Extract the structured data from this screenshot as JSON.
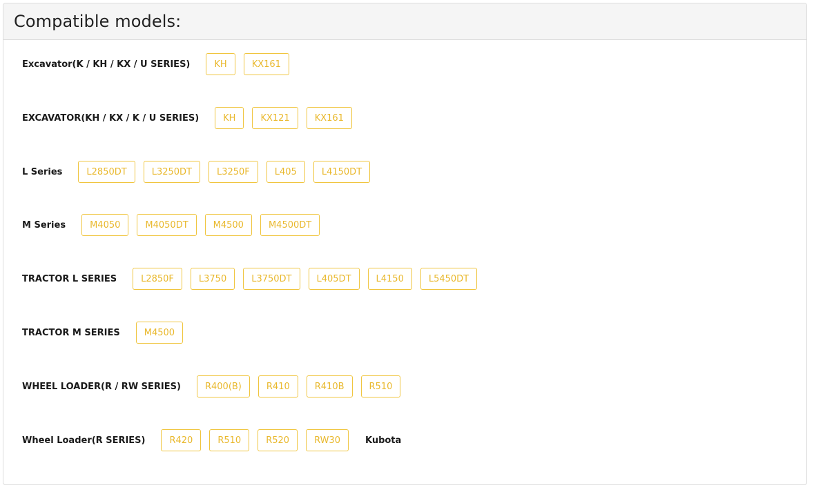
{
  "panel": {
    "title": "Compatible models:"
  },
  "rows": [
    {
      "label": "Excavator(K / KH / KX / U SERIES)",
      "tags": [
        "KH",
        "KX161"
      ]
    },
    {
      "label": "EXCAVATOR(KH / KX / K / U SERIES)",
      "tags": [
        "KH",
        "KX121",
        "KX161"
      ]
    },
    {
      "label": "L Series",
      "tags": [
        "L2850DT",
        "L3250DT",
        "L3250F",
        "L405",
        "L4150DT"
      ]
    },
    {
      "label": "M Series",
      "tags": [
        "M4050",
        "M4050DT",
        "M4500",
        "M4500DT"
      ]
    },
    {
      "label": "TRACTOR L SERIES",
      "tags": [
        "L2850F",
        "L3750",
        "L3750DT",
        "L405DT",
        "L4150",
        "L5450DT"
      ]
    },
    {
      "label": "TRACTOR M SERIES",
      "tags": [
        "M4500"
      ]
    },
    {
      "label": "WHEEL LOADER(R / RW SERIES)",
      "tags": [
        "R400(B)",
        "R410",
        "R410B",
        "R510"
      ]
    },
    {
      "label": "Wheel Loader(R SERIES)",
      "tags": [
        "R420",
        "R510",
        "R520",
        "RW30"
      ],
      "brand": "Kubota"
    }
  ],
  "colors": {
    "tag_border": "#f0c53e",
    "tag_text": "#e9b82c",
    "header_bg": "#f5f5f5"
  }
}
